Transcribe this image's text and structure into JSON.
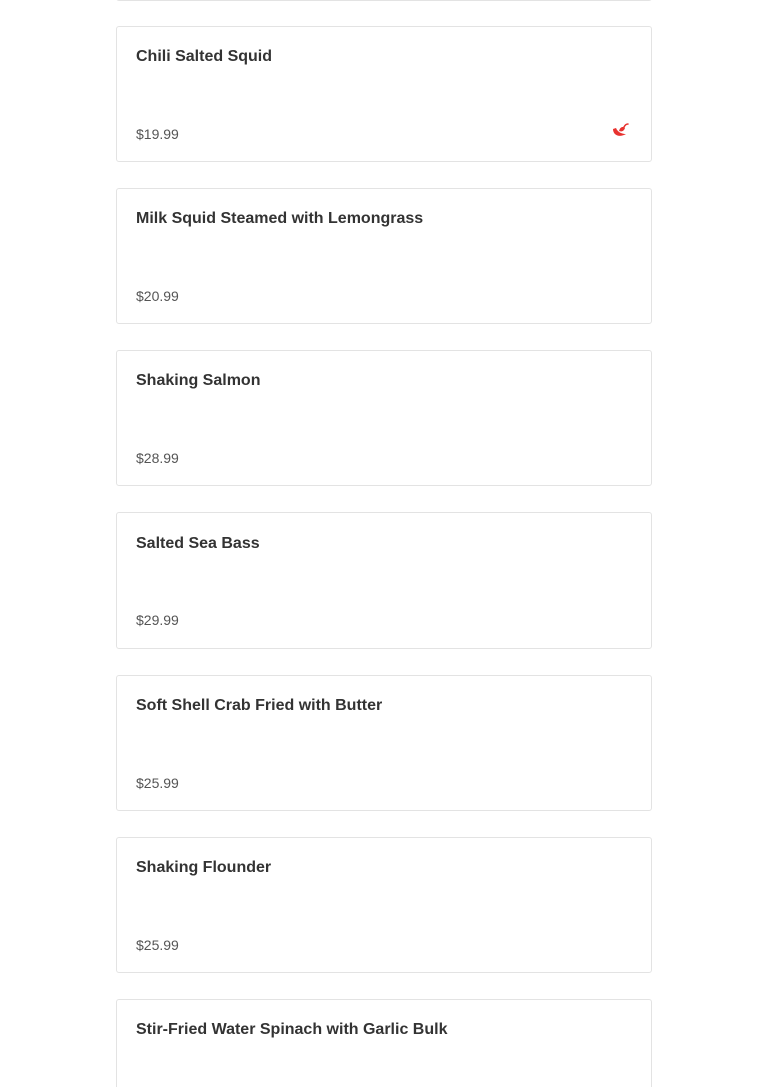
{
  "menu_items": [
    {
      "name": "Chili Salted Squid",
      "price": "$19.99",
      "spicy": true,
      "icon": "chili-pepper-icon",
      "icon_color": "#e8322f"
    },
    {
      "name": "Milk Squid Steamed with Lemongrass",
      "price": "$20.99",
      "spicy": false
    },
    {
      "name": "Shaking Salmon",
      "price": "$28.99",
      "spicy": false
    },
    {
      "name": "Salted Sea Bass",
      "price": "$29.99",
      "spicy": false
    },
    {
      "name": "Soft Shell Crab Fried with Butter",
      "price": "$25.99",
      "spicy": false
    },
    {
      "name": "Shaking Flounder",
      "price": "$25.99",
      "spicy": false
    },
    {
      "name": "Stir-Fried Water Spinach with Garlic Bulk",
      "price": "",
      "spicy": false
    }
  ]
}
